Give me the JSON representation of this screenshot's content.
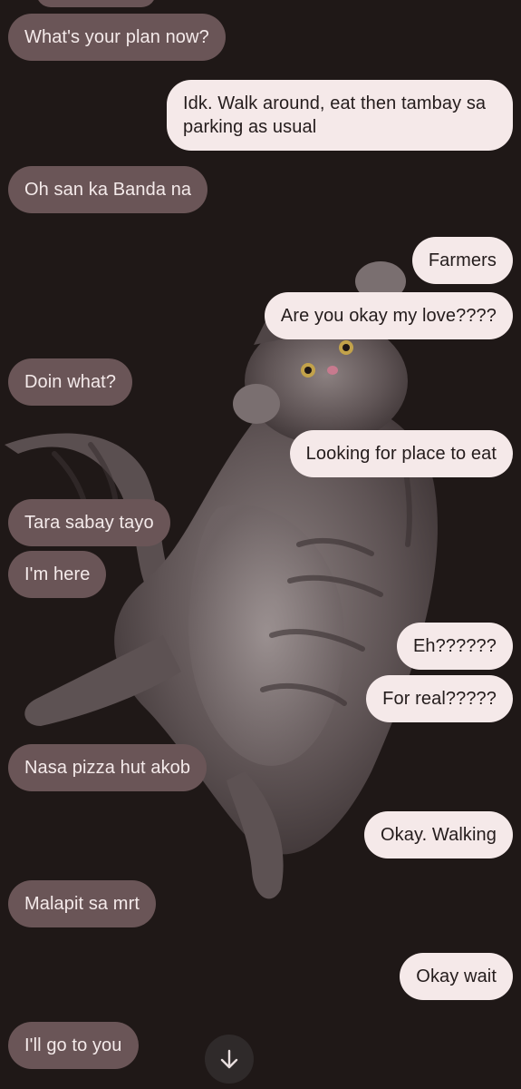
{
  "messages": [
    {
      "from": "them",
      "text": "What's your plan now?"
    },
    {
      "from": "me",
      "text": "Idk. Walk around, eat then tambay sa parking as usual"
    },
    {
      "from": "them",
      "text": "Oh san ka Banda na"
    },
    {
      "from": "me",
      "text": "Farmers"
    },
    {
      "from": "me",
      "text": "Are you okay my love????"
    },
    {
      "from": "them",
      "text": "Doin what?"
    },
    {
      "from": "me",
      "text": "Looking for place to eat"
    },
    {
      "from": "them",
      "text": "Tara sabay tayo"
    },
    {
      "from": "them",
      "text": "I'm here"
    },
    {
      "from": "me",
      "text": "Eh??????"
    },
    {
      "from": "me",
      "text": "For real?????"
    },
    {
      "from": "them",
      "text": "Nasa pizza hut akob"
    },
    {
      "from": "me",
      "text": "Okay. Walking"
    },
    {
      "from": "them",
      "text": "Malapit sa mrt"
    },
    {
      "from": "me",
      "text": "Okay wait"
    },
    {
      "from": "them",
      "text": "I'll go to you"
    }
  ],
  "wallpaper": {
    "subject": "gray tabby cat"
  },
  "scroll_button": {
    "icon": "arrow-down-icon"
  },
  "colors": {
    "background": "#1f1817",
    "incoming_bubble": "#6a5557",
    "outgoing_bubble": "#f5e9e9"
  }
}
